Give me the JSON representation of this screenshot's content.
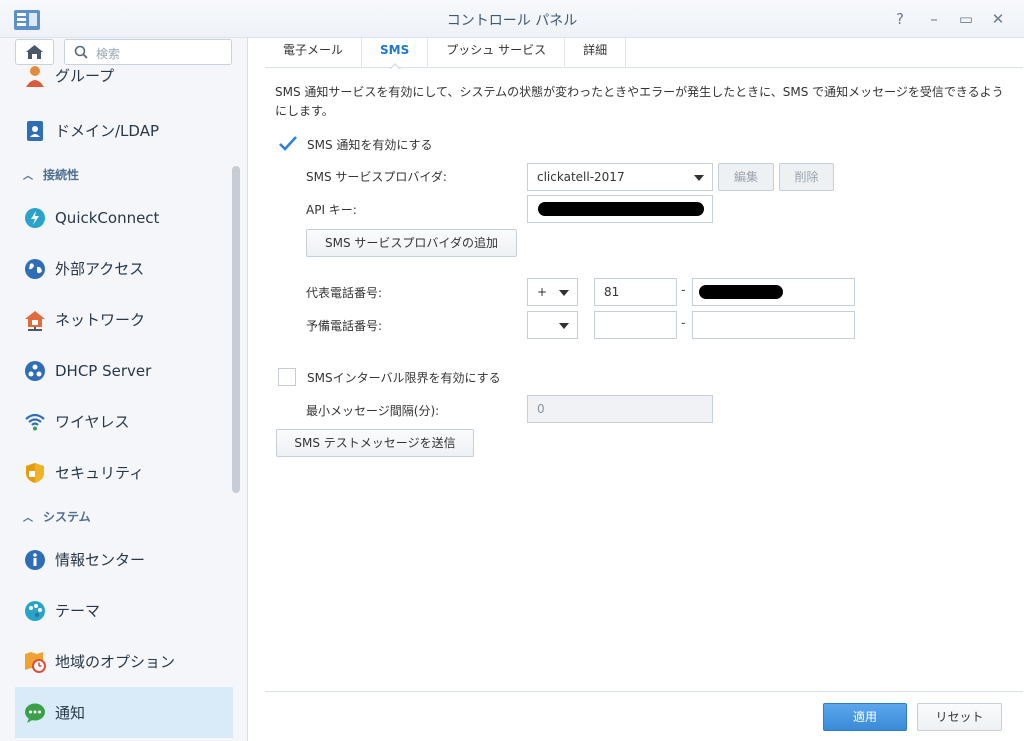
{
  "window": {
    "title": "コントロール パネル",
    "controls": {
      "help": "?",
      "minimize": "–",
      "maximize": "▭",
      "close": "✕"
    }
  },
  "sidebar": {
    "search_placeholder": "検索",
    "items": [
      {
        "label": "グループ",
        "icon": "group-icon"
      },
      {
        "label": "ドメイン/LDAP",
        "icon": "domain-icon"
      },
      {
        "section": "接続性"
      },
      {
        "label": "QuickConnect",
        "icon": "quickconnect-icon"
      },
      {
        "label": "外部アクセス",
        "icon": "globe-icon"
      },
      {
        "label": "ネットワーク",
        "icon": "network-icon"
      },
      {
        "label": "DHCP Server",
        "icon": "dhcp-icon"
      },
      {
        "label": "ワイヤレス",
        "icon": "wifi-icon"
      },
      {
        "label": "セキュリティ",
        "icon": "shield-icon"
      },
      {
        "section": "システム"
      },
      {
        "label": "情報センター",
        "icon": "info-icon"
      },
      {
        "label": "テーマ",
        "icon": "palette-icon"
      },
      {
        "label": "地域のオプション",
        "icon": "region-icon"
      },
      {
        "label": "通知",
        "icon": "chat-icon",
        "active": true
      }
    ]
  },
  "tabs": [
    "電子メール",
    "SMS",
    "プッシュ サービス",
    "詳細"
  ],
  "active_tab": "SMS",
  "sms": {
    "description": "SMS 通知サービスを有効にして、システムの状態が変わったときやエラーが発生したときに、SMS で通知メッセージを受信できるようにします。",
    "enable_label": "SMS 通知を有効にする",
    "enable_checked": true,
    "provider_label": "SMS サービスプロバイダ:",
    "provider_value": "clickatell-2017",
    "edit_button": "編集",
    "delete_button": "削除",
    "api_key_label": "API キー:",
    "add_provider_button": "SMS サービスプロバイダの追加",
    "primary_phone_label": "代表電話番号:",
    "primary_prefix": "+",
    "primary_country_code": "81",
    "secondary_phone_label": "予備電話番号:",
    "secondary_prefix": "",
    "secondary_country_code": "",
    "secondary_number": "",
    "dash": "-",
    "interval_label": "SMSインターバル限界を有効にする",
    "interval_checked": false,
    "min_interval_label": "最小メッセージ間隔(分):",
    "min_interval_value": "0",
    "test_button": "SMS テストメッセージを送信"
  },
  "footer": {
    "apply": "適用",
    "reset": "リセット"
  },
  "colors": {
    "accent": "#1d77c9",
    "active_item_bg": "#d9eaf9",
    "primary_button": "#3a8ad8"
  }
}
